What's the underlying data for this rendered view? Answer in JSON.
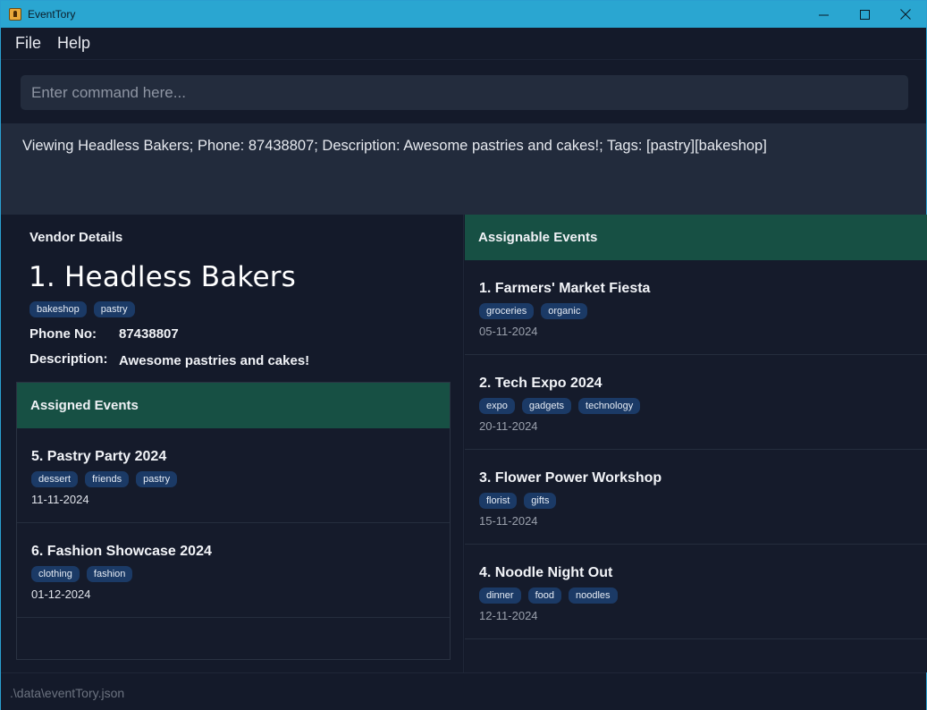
{
  "window": {
    "title": "EventTory"
  },
  "menu": {
    "items": [
      {
        "label": "File"
      },
      {
        "label": "Help"
      }
    ]
  },
  "command": {
    "placeholder": "Enter command here..."
  },
  "result": {
    "text": "Viewing Headless Bakers; Phone: 87438807; Description: Awesome pastries and cakes!; Tags: [pastry][bakeshop]"
  },
  "vendor": {
    "section_label": "Vendor Details",
    "name": "1. Headless Bakers",
    "tags": [
      "bakeshop",
      "pastry"
    ],
    "phone_label": "Phone No:",
    "phone": "87438807",
    "description_label": "Description:",
    "description": "Awesome pastries and cakes!"
  },
  "assigned": {
    "header": "Assigned Events",
    "events": [
      {
        "title": "5.  Pastry Party 2024",
        "tags": [
          "dessert",
          "friends",
          "pastry"
        ],
        "date": "11-11-2024"
      },
      {
        "title": "6.  Fashion Showcase 2024",
        "tags": [
          "clothing",
          "fashion"
        ],
        "date": "01-12-2024"
      }
    ]
  },
  "assignable": {
    "header": "Assignable Events",
    "events": [
      {
        "title": "1.  Farmers' Market Fiesta",
        "tags": [
          "groceries",
          "organic"
        ],
        "date": "05-11-2024"
      },
      {
        "title": "2.  Tech Expo 2024",
        "tags": [
          "expo",
          "gadgets",
          "technology"
        ],
        "date": "20-11-2024"
      },
      {
        "title": "3.  Flower Power Workshop",
        "tags": [
          "florist",
          "gifts"
        ],
        "date": "15-11-2024"
      },
      {
        "title": "4.  Noodle Night Out",
        "tags": [
          "dinner",
          "food",
          "noodles"
        ],
        "date": "12-11-2024"
      }
    ]
  },
  "status": {
    "path": ".\\data\\eventTory.json"
  },
  "colors": {
    "titlebar": "#2aa6d1",
    "background": "#141a2a",
    "list_header": "#175044",
    "tag": "#1b3a66"
  },
  "icons": {
    "app": "app-icon",
    "minimize": "minimize-icon",
    "maximize": "maximize-icon",
    "close": "close-icon"
  }
}
